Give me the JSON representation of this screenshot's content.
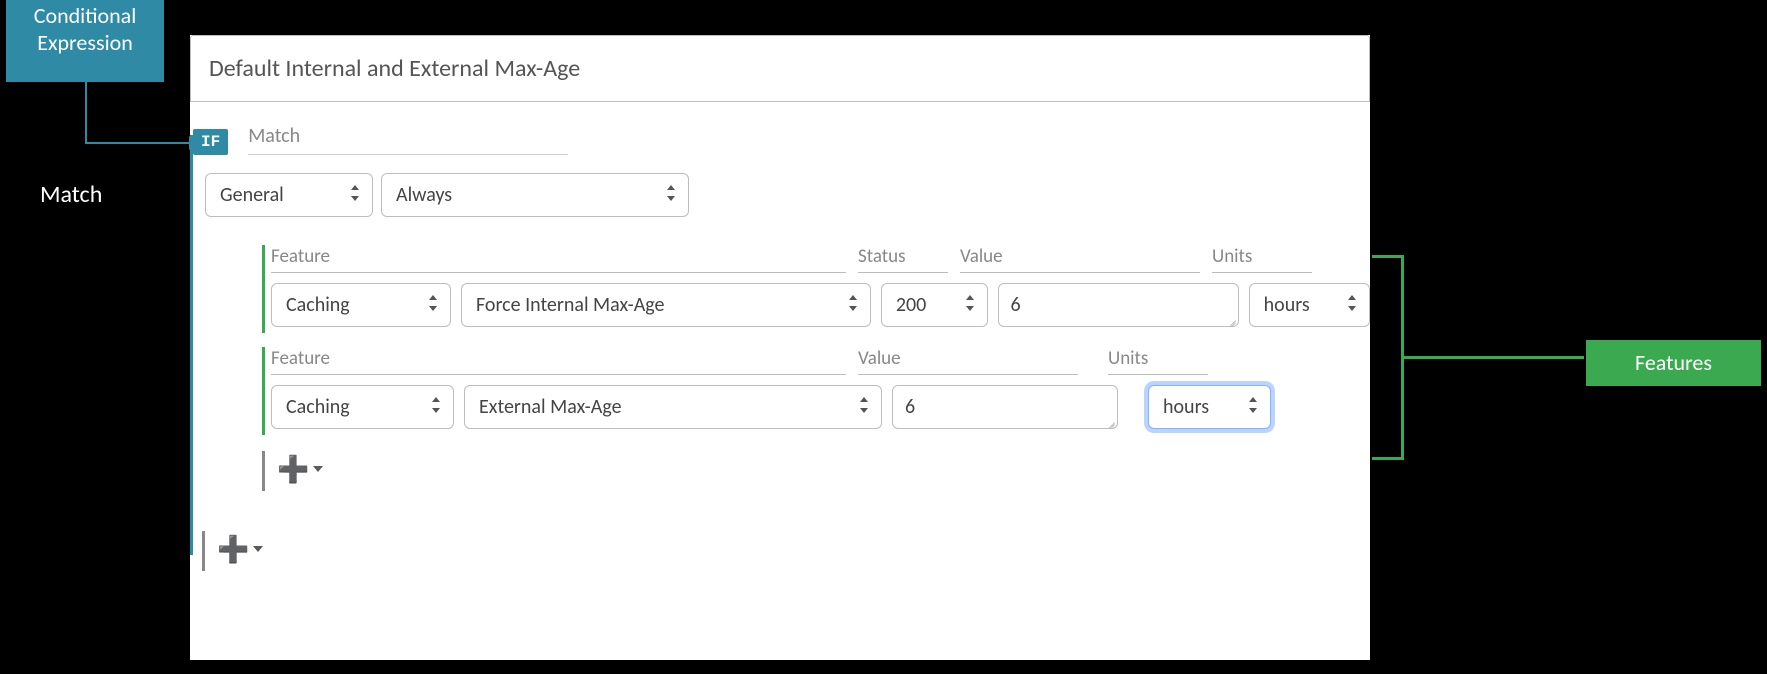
{
  "callouts": {
    "conditional_l1": "Conditional",
    "conditional_l2": "Expression",
    "match": "Match",
    "features": "Features"
  },
  "panel": {
    "title": "Default Internal and External Max-Age"
  },
  "rule": {
    "if_badge": "IF",
    "if_section_label": "Match",
    "match": {
      "category": "General",
      "condition": "Always"
    },
    "feature_label": "Feature",
    "status_label": "Status",
    "value_label": "Value",
    "units_label": "Units",
    "features": [
      {
        "category": "Caching",
        "name": "Force Internal Max-Age",
        "status": "200",
        "value": "6",
        "units": "hours"
      },
      {
        "category": "Caching",
        "name": "External Max-Age",
        "value": "6",
        "units": "hours"
      }
    ]
  }
}
